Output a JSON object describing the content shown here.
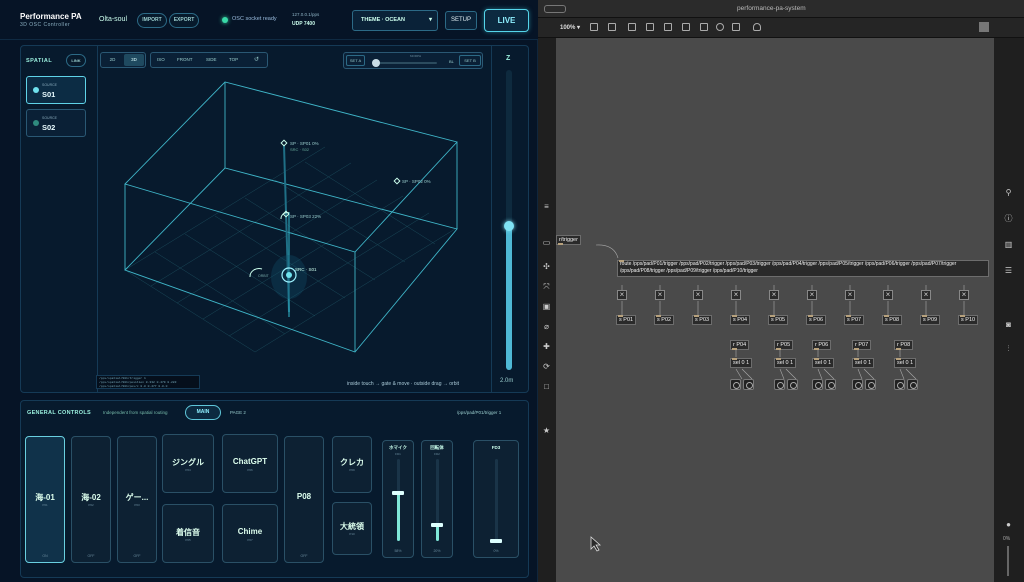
{
  "app": {
    "title": "Performance PA",
    "subtitle": "3D OSC Controller",
    "user": "Olta-soul",
    "import": "IMPORT",
    "export": "EXPORT",
    "status": "OSC socket ready",
    "ip": "127.0.0.1/pps",
    "udp": "UDP 7400",
    "theme": "THEME · OCEAN",
    "setup": "SETUP",
    "live": "LIVE"
  },
  "spatial": {
    "label": "SPATIAL",
    "link": "LINK",
    "sources": [
      {
        "caption": "SOURCE",
        "name": "S01"
      },
      {
        "caption": "SOURCE",
        "name": "S02"
      }
    ],
    "modes": [
      "2D",
      "3D"
    ],
    "views": [
      "ISO",
      "FRONT",
      "SIDE",
      "TOP",
      "↺"
    ],
    "set_a": "SET A",
    "set_b": "SET B",
    "morph": "MORPH",
    "bl": "BL",
    "z": "Z",
    "z_value": "2.0m",
    "z_level": 0.48,
    "hint": "inside touch → gate & move · outside drag → orbit",
    "points": [
      {
        "label": "SP · SP01 0%",
        "sub": "SRC · S02"
      },
      {
        "label": "SP · SP02 0%"
      },
      {
        "label": "SP · SP03 22%"
      },
      {
        "label": "SRC · S01"
      },
      {
        "label": "ORBIT"
      }
    ],
    "log": [
      "/pps/spatial/S01/trigger 1",
      "/pps/spatial/S01/position 0.332 0.479 0.283",
      "/pps/spatial/S01/pos/c 0.0 0.477 0.0.0"
    ]
  },
  "controls": {
    "label": "GENERAL CONTROLS",
    "desc": "Independent from spatial routing",
    "main": "MAIN",
    "page2": "PAGE 2",
    "path": "/pps/pad/P01/trigger 1",
    "pads": [
      {
        "label": "海-01",
        "sub": "P01",
        "state": "ON"
      },
      {
        "label": "海-02",
        "sub": "P02",
        "state": "OFF"
      },
      {
        "label": "ゲー...",
        "sub": "P03",
        "state": "OFF"
      },
      {
        "label": "ジングル",
        "sub": "P04"
      },
      {
        "label": "ChatGPT",
        "sub": "P06"
      },
      {
        "label": "着信音",
        "sub": "P05"
      },
      {
        "label": "Chime",
        "sub": "P07"
      },
      {
        "label": "P08",
        "state": "OFF"
      },
      {
        "label": "クレカ",
        "sub": "P09"
      },
      {
        "label": "大統領",
        "sub": "P10"
      }
    ],
    "faders": [
      {
        "name": "ホマイク",
        "sub": "FD1",
        "value": "58%",
        "level": 0.58
      },
      {
        "name": "回転体",
        "sub": "FD2",
        "value": "20%",
        "level": 0.2
      },
      {
        "name": "FD3",
        "sub": "",
        "value": "0%",
        "level": 0.0
      }
    ]
  },
  "max": {
    "title": "performance-pa-system",
    "zoom": "100% ▾",
    "trigger": "r/trigger",
    "route": "route /pps/pad/P01/trigger /pps/pad/P02/trigger /pps/pad/P03/trigger /pps/pad/P04/trigger /pps/pad/P05/trigger /pps/pad/P06/trigger /pps/pad/P07/trigger /pps/pad/P08/trigger /pps/pad/P09/trigger /pps/pad/P10/trigger",
    "sends": [
      "s P01",
      "s P02",
      "s P03",
      "s P04",
      "s P05",
      "s P06",
      "s P07",
      "s P08",
      "s P09",
      "s P10"
    ],
    "receives": [
      "r P04",
      "r P05",
      "r P06",
      "r P07",
      "r P08"
    ],
    "sel": "sel 0 1",
    "zoom_bottom": "0%"
  }
}
